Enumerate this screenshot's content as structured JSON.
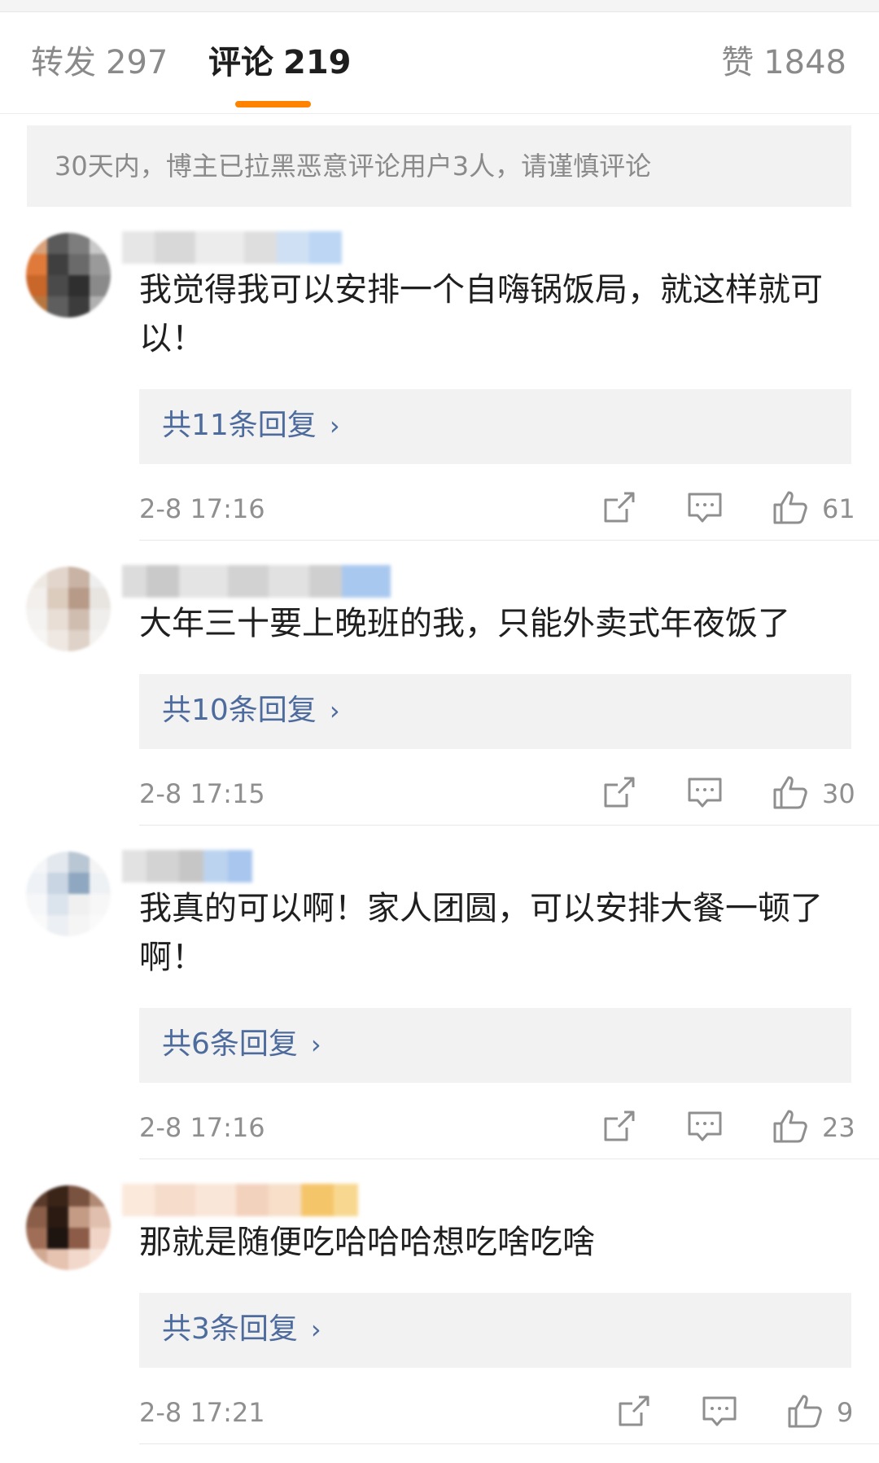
{
  "tabs": {
    "repost": {
      "label": "转发",
      "count": "297"
    },
    "comments": {
      "label": "评论",
      "count": "219"
    },
    "likes": {
      "label": "赞",
      "count": "1848"
    }
  },
  "notice": "30天内，博主已拉黑恶意评论用户3人，请谨慎评论",
  "comments": [
    {
      "text": "我觉得我可以安排一个自嗨锅饭局，就这样就可以！",
      "replies": "共11条回复",
      "time": "2-8 17:16",
      "likes": "61"
    },
    {
      "text": "大年三十要上晚班的我，只能外卖式年夜饭了",
      "replies": "共10条回复",
      "time": "2-8 17:15",
      "likes": "30"
    },
    {
      "text": "我真的可以啊！家人团圆，可以安排大餐一顿了啊！",
      "replies": "共6条回复",
      "time": "2-8 17:16",
      "likes": "23"
    },
    {
      "text": "那就是随便吃哈哈哈想吃啥吃啥",
      "replies": "共3条回复",
      "time": "2-8 17:21",
      "likes": "9"
    }
  ],
  "icons": {
    "reply_chevron": "chevron-right-icon",
    "share": "share-icon",
    "comment": "comment-icon",
    "like": "thumbs-up-icon"
  },
  "colors": {
    "accent": "#ff8200",
    "reply_link": "#4d6b9c",
    "muted_text": "#8f8f8f",
    "panel_bg": "#f2f2f2"
  }
}
